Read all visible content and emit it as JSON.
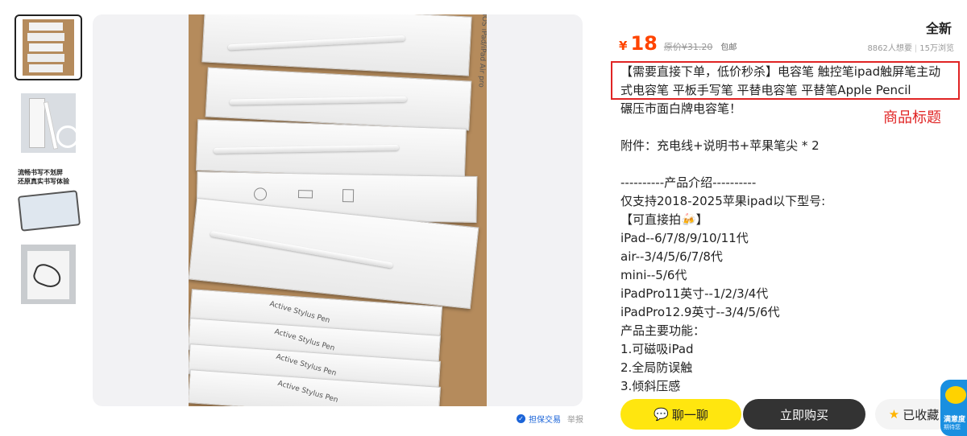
{
  "listing": {
    "condition": "全新",
    "currency": "¥",
    "price": "18",
    "original_price": "原价¥31.20",
    "shipping": "包邮",
    "wants": "8862人想要",
    "views": "15万浏览",
    "description": "【需要直接下单，低价秒杀】电容笔 触控笔ipad触屏笔主动\n式电容笔 平板手写笔 平替电容笔 平替笔Apple Pencil\n碾压市面白牌电容笔！\n\n附件：充电线+说明书+苹果笔尖 * 2\n\n----------产品介绍----------\n仅支持2018-2025苹果ipad以下型号:\n【可直接拍🍻】\niPad--6/7/8/9/10/11代\nair--3/4/5/6/7/8代\nmini--5/6代\niPadPro11英寸--1/2/3/4代\niPadPro12.9英寸--3/4/5/6代\n产品主要功能：\n1.可磁吸iPad\n2.全局防误触\n3.倾斜压感",
    "annotation": "商品标题"
  },
  "image_area": {
    "guarantee": "担保交易",
    "report": "举报",
    "box_text_front": "Active Stylus Pen",
    "box_text_spine": "for iOS iPad/iPad Air pro",
    "thumb_caption_1": "流畅书写不划屏",
    "thumb_caption_2": "还原真实书写体验"
  },
  "actions": {
    "chat": "聊一聊",
    "buy": "立即购买",
    "favorite": "已收藏"
  },
  "mascot": {
    "text1": "满意度",
    "text2": "期待您"
  },
  "colors": {
    "price": "#ff4400",
    "chat_button": "#ffe60f",
    "buy_button": "#333333",
    "highlight": "#e02424",
    "link": "#1b64d8"
  },
  "icons": [
    "chat-icon",
    "star-icon",
    "shield-icon"
  ]
}
